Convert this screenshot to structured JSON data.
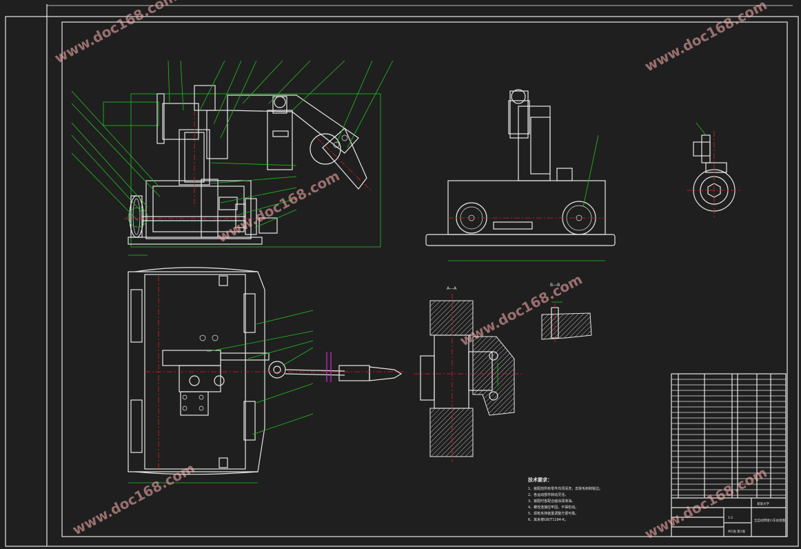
{
  "drawing": {
    "tech_req_title": "技术要求：",
    "tech_notes": [
      "1、装配前所有零件均须清洗，去除毛刺和锐边。",
      "2、各运动部件转动灵活。",
      "3、装配时各配合面涂润滑油。",
      "4、螺栓连接应牢固，不得松动。",
      "5、焊枪夹持装置调整方便可靠。",
      "6、其余按GB/T1184-K。"
    ],
    "section_label_1": "A—A",
    "section_label_2": "B—B",
    "title_block": {
      "drawing_name": "全自动焊接小车总装图",
      "school": "某某大学",
      "scale": "1:2",
      "sheet": "共1张 第1张"
    },
    "watermark": "www.doc168.com"
  }
}
